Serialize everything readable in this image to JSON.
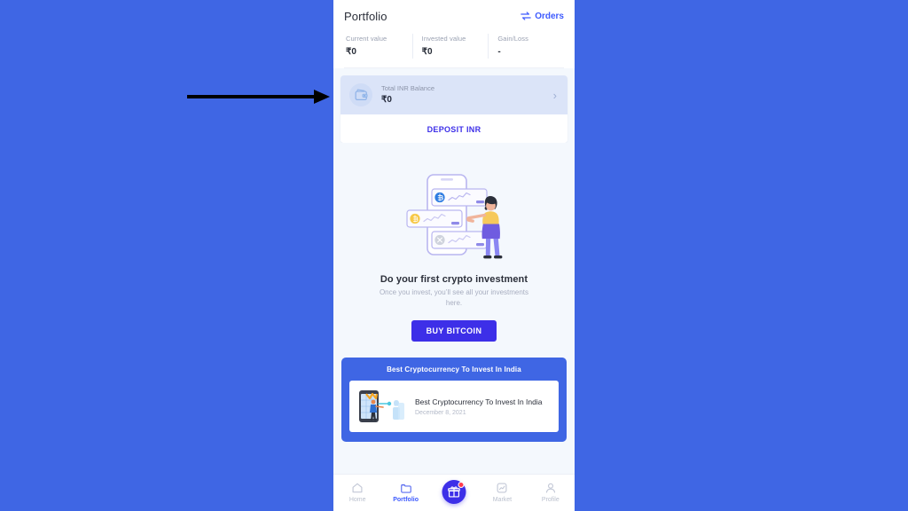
{
  "annotation": {
    "arrow": "right-pointing-arrow"
  },
  "colors": {
    "background": "#3f66e4",
    "app_background": "#f4f8fd",
    "accent_blue": "#3d5afe",
    "primary_indigo": "#3d2fe8",
    "balance_card": "#dbe4f8",
    "muted_text": "#9aa1b2",
    "notification_dot": "#ff3b4e"
  },
  "header": {
    "title": "Portfolio",
    "orders_label": "Orders",
    "orders_icon": "swap-arrows-icon",
    "stats": [
      {
        "label": "Current value",
        "value": "₹0"
      },
      {
        "label": "Invested value",
        "value": "₹0"
      },
      {
        "label": "Gain/Loss",
        "value": "-"
      }
    ]
  },
  "balance": {
    "icon": "wallet-icon",
    "label": "Total INR Balance",
    "value": "₹0",
    "chevron": "›",
    "deposit_label": "DEPOSIT INR"
  },
  "empty_state": {
    "illustration": "woman-with-phone-crypto-charts-illustration",
    "title": "Do your first crypto investment",
    "subtitle": "Once you invest, you’ll see all your investments here.",
    "cta_label": "BUY BITCOIN"
  },
  "blog": {
    "section_title": "Best Cryptocurrency To Invest In India",
    "article": {
      "thumbnail": "person-with-phone-illustration",
      "title": "Best Cryptocurrency To Invest In India",
      "date": "December 8, 2021"
    }
  },
  "bottom_nav": {
    "items": [
      {
        "label": "Home",
        "icon": "home-icon",
        "active": false
      },
      {
        "label": "Portfolio",
        "icon": "folder-icon",
        "active": true
      },
      {
        "label": "Market",
        "icon": "market-chart-icon",
        "active": false
      },
      {
        "label": "Profile",
        "icon": "person-icon",
        "active": false
      }
    ],
    "fab": {
      "icon": "gift-box-icon",
      "has_badge": true
    }
  }
}
